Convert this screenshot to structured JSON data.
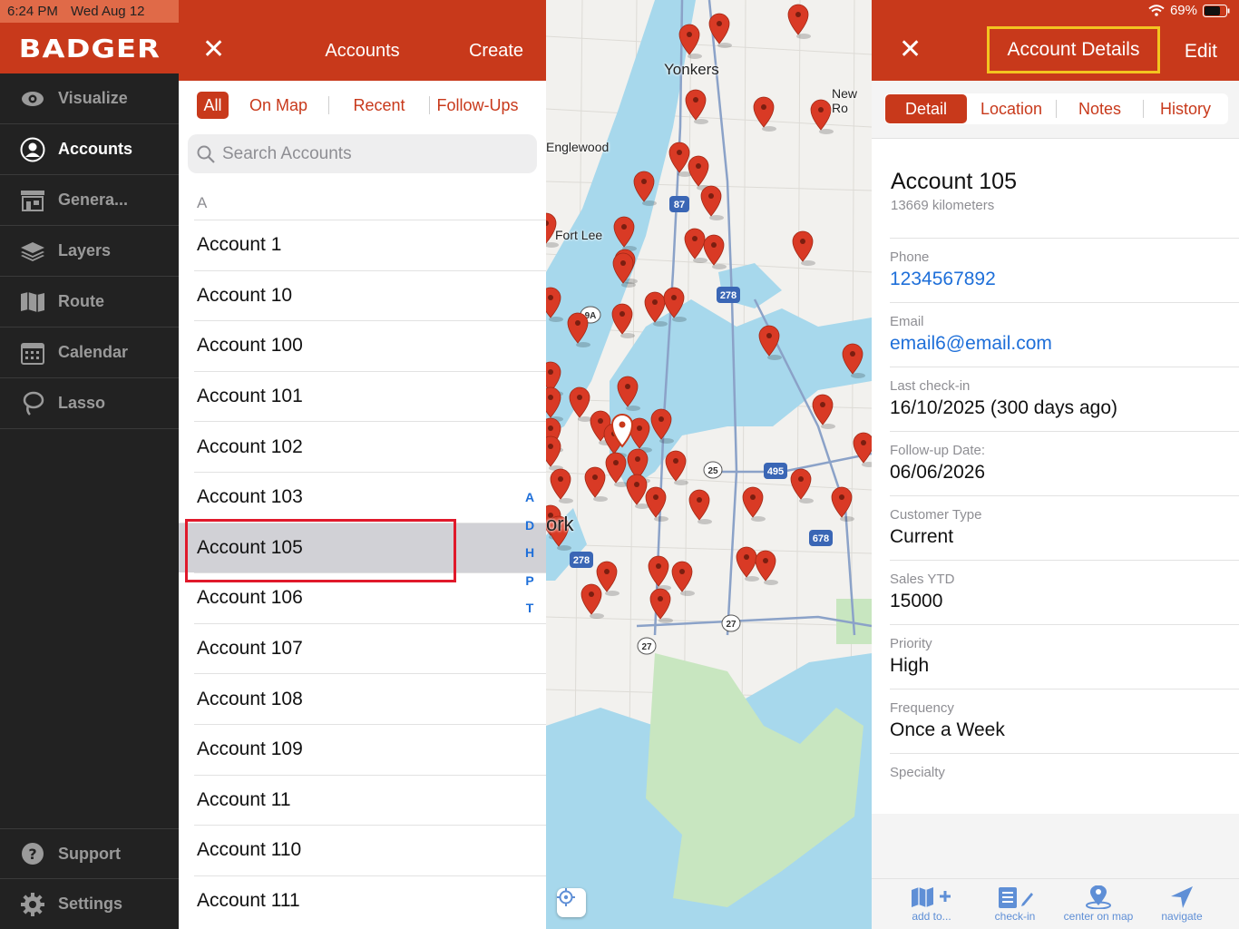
{
  "status_bar": {
    "time": "6:24 PM",
    "date": "Wed Aug 12",
    "battery": "69%"
  },
  "brand": "BADGER",
  "nav": [
    {
      "label": "Visualize",
      "icon": "eye-icon"
    },
    {
      "label": "Accounts",
      "icon": "person-circle-icon",
      "active": true
    },
    {
      "label": "Genera...",
      "icon": "store-icon"
    },
    {
      "label": "Layers",
      "icon": "layers-icon"
    },
    {
      "label": "Route",
      "icon": "map-icon"
    },
    {
      "label": "Calendar",
      "icon": "calendar-icon"
    },
    {
      "label": "Lasso",
      "icon": "lasso-icon"
    }
  ],
  "nav_bottom": [
    {
      "label": "Support",
      "icon": "question-icon"
    },
    {
      "label": "Settings",
      "icon": "gear-icon"
    }
  ],
  "accounts_panel": {
    "title": "Accounts",
    "create_label": "Create",
    "close_label": "✕",
    "filters": [
      "All",
      "On Map",
      "Recent",
      "Follow-Ups"
    ],
    "active_filter": "All",
    "search_placeholder": "Search Accounts",
    "section": "A",
    "rows": [
      "Account 1",
      "Account 10",
      "Account 100",
      "Account 101",
      "Account 102",
      "Account 103",
      "Account 105",
      "Account 106",
      "Account 107",
      "Account 108",
      "Account 109",
      "Account 11",
      "Account 110",
      "Account 111"
    ],
    "selected_row": "Account 105",
    "index_letters": [
      "A",
      "D",
      "H",
      "P",
      "T"
    ]
  },
  "map": {
    "labels": [
      "Yonkers",
      "New Ro",
      "Englewood",
      "Fort Lee",
      "ork"
    ],
    "shields": [
      "87",
      "278",
      "9A",
      "25",
      "495",
      "678",
      "278",
      "27",
      "27"
    ],
    "colors": {
      "water": "#a7d8ec",
      "land": "#f2f1ee",
      "pin": "#d93a25",
      "park": "#c8e6c0"
    }
  },
  "detail_panel": {
    "close_label": "✕",
    "title": "Account Details",
    "edit_label": "Edit",
    "tabs": [
      "Detail",
      "Location",
      "Notes",
      "History"
    ],
    "active_tab": "Detail",
    "account_name": "Account 105",
    "distance": "13669 kilometers",
    "fields": [
      {
        "label": "Phone",
        "value": "1234567892",
        "link": true
      },
      {
        "label": "Email",
        "value": "email6@email.com",
        "link": true
      },
      {
        "label": "Last check-in",
        "value": "16/10/2025 (300 days ago)"
      },
      {
        "label": "Follow-up Date:",
        "value": "06/06/2026"
      },
      {
        "label": "Customer Type",
        "value": "Current"
      },
      {
        "label": "Sales YTD",
        "value": "15000"
      },
      {
        "label": "Priority",
        "value": "High"
      },
      {
        "label": "Frequency",
        "value": "Once a Week"
      },
      {
        "label": "Specialty",
        "value": ""
      }
    ],
    "footer": [
      {
        "label": "add to...",
        "icon": "map-plus-icon"
      },
      {
        "label": "check-in",
        "icon": "note-edit-icon"
      },
      {
        "label": "center on map",
        "icon": "pin-icon"
      },
      {
        "label": "navigate",
        "icon": "navigate-arrow-icon"
      }
    ]
  },
  "colors": {
    "brand": "#c8391b",
    "sidebar": "#222222",
    "link": "#1e6fd9",
    "highlight_red": "#e0192b",
    "highlight_yellow": "#f3c420"
  }
}
